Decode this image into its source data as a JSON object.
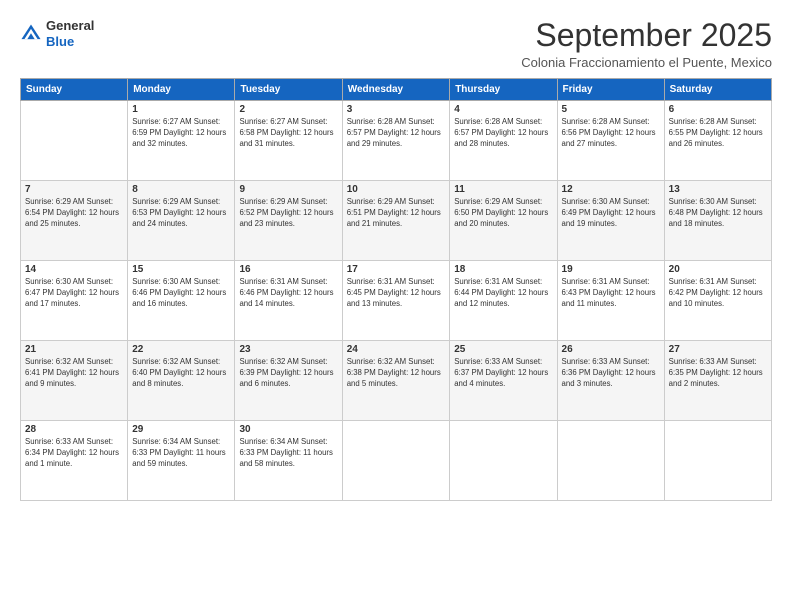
{
  "header": {
    "logo_general": "General",
    "logo_blue": "Blue",
    "month_title": "September 2025",
    "subtitle": "Colonia Fraccionamiento el Puente, Mexico"
  },
  "weekdays": [
    "Sunday",
    "Monday",
    "Tuesday",
    "Wednesday",
    "Thursday",
    "Friday",
    "Saturday"
  ],
  "weeks": [
    [
      {
        "day": "",
        "info": ""
      },
      {
        "day": "1",
        "info": "Sunrise: 6:27 AM\nSunset: 6:59 PM\nDaylight: 12 hours\nand 32 minutes."
      },
      {
        "day": "2",
        "info": "Sunrise: 6:27 AM\nSunset: 6:58 PM\nDaylight: 12 hours\nand 31 minutes."
      },
      {
        "day": "3",
        "info": "Sunrise: 6:28 AM\nSunset: 6:57 PM\nDaylight: 12 hours\nand 29 minutes."
      },
      {
        "day": "4",
        "info": "Sunrise: 6:28 AM\nSunset: 6:57 PM\nDaylight: 12 hours\nand 28 minutes."
      },
      {
        "day": "5",
        "info": "Sunrise: 6:28 AM\nSunset: 6:56 PM\nDaylight: 12 hours\nand 27 minutes."
      },
      {
        "day": "6",
        "info": "Sunrise: 6:28 AM\nSunset: 6:55 PM\nDaylight: 12 hours\nand 26 minutes."
      }
    ],
    [
      {
        "day": "7",
        "info": "Sunrise: 6:29 AM\nSunset: 6:54 PM\nDaylight: 12 hours\nand 25 minutes."
      },
      {
        "day": "8",
        "info": "Sunrise: 6:29 AM\nSunset: 6:53 PM\nDaylight: 12 hours\nand 24 minutes."
      },
      {
        "day": "9",
        "info": "Sunrise: 6:29 AM\nSunset: 6:52 PM\nDaylight: 12 hours\nand 23 minutes."
      },
      {
        "day": "10",
        "info": "Sunrise: 6:29 AM\nSunset: 6:51 PM\nDaylight: 12 hours\nand 21 minutes."
      },
      {
        "day": "11",
        "info": "Sunrise: 6:29 AM\nSunset: 6:50 PM\nDaylight: 12 hours\nand 20 minutes."
      },
      {
        "day": "12",
        "info": "Sunrise: 6:30 AM\nSunset: 6:49 PM\nDaylight: 12 hours\nand 19 minutes."
      },
      {
        "day": "13",
        "info": "Sunrise: 6:30 AM\nSunset: 6:48 PM\nDaylight: 12 hours\nand 18 minutes."
      }
    ],
    [
      {
        "day": "14",
        "info": "Sunrise: 6:30 AM\nSunset: 6:47 PM\nDaylight: 12 hours\nand 17 minutes."
      },
      {
        "day": "15",
        "info": "Sunrise: 6:30 AM\nSunset: 6:46 PM\nDaylight: 12 hours\nand 16 minutes."
      },
      {
        "day": "16",
        "info": "Sunrise: 6:31 AM\nSunset: 6:46 PM\nDaylight: 12 hours\nand 14 minutes."
      },
      {
        "day": "17",
        "info": "Sunrise: 6:31 AM\nSunset: 6:45 PM\nDaylight: 12 hours\nand 13 minutes."
      },
      {
        "day": "18",
        "info": "Sunrise: 6:31 AM\nSunset: 6:44 PM\nDaylight: 12 hours\nand 12 minutes."
      },
      {
        "day": "19",
        "info": "Sunrise: 6:31 AM\nSunset: 6:43 PM\nDaylight: 12 hours\nand 11 minutes."
      },
      {
        "day": "20",
        "info": "Sunrise: 6:31 AM\nSunset: 6:42 PM\nDaylight: 12 hours\nand 10 minutes."
      }
    ],
    [
      {
        "day": "21",
        "info": "Sunrise: 6:32 AM\nSunset: 6:41 PM\nDaylight: 12 hours\nand 9 minutes."
      },
      {
        "day": "22",
        "info": "Sunrise: 6:32 AM\nSunset: 6:40 PM\nDaylight: 12 hours\nand 8 minutes."
      },
      {
        "day": "23",
        "info": "Sunrise: 6:32 AM\nSunset: 6:39 PM\nDaylight: 12 hours\nand 6 minutes."
      },
      {
        "day": "24",
        "info": "Sunrise: 6:32 AM\nSunset: 6:38 PM\nDaylight: 12 hours\nand 5 minutes."
      },
      {
        "day": "25",
        "info": "Sunrise: 6:33 AM\nSunset: 6:37 PM\nDaylight: 12 hours\nand 4 minutes."
      },
      {
        "day": "26",
        "info": "Sunrise: 6:33 AM\nSunset: 6:36 PM\nDaylight: 12 hours\nand 3 minutes."
      },
      {
        "day": "27",
        "info": "Sunrise: 6:33 AM\nSunset: 6:35 PM\nDaylight: 12 hours\nand 2 minutes."
      }
    ],
    [
      {
        "day": "28",
        "info": "Sunrise: 6:33 AM\nSunset: 6:34 PM\nDaylight: 12 hours\nand 1 minute."
      },
      {
        "day": "29",
        "info": "Sunrise: 6:34 AM\nSunset: 6:33 PM\nDaylight: 11 hours\nand 59 minutes."
      },
      {
        "day": "30",
        "info": "Sunrise: 6:34 AM\nSunset: 6:33 PM\nDaylight: 11 hours\nand 58 minutes."
      },
      {
        "day": "",
        "info": ""
      },
      {
        "day": "",
        "info": ""
      },
      {
        "day": "",
        "info": ""
      },
      {
        "day": "",
        "info": ""
      }
    ]
  ]
}
